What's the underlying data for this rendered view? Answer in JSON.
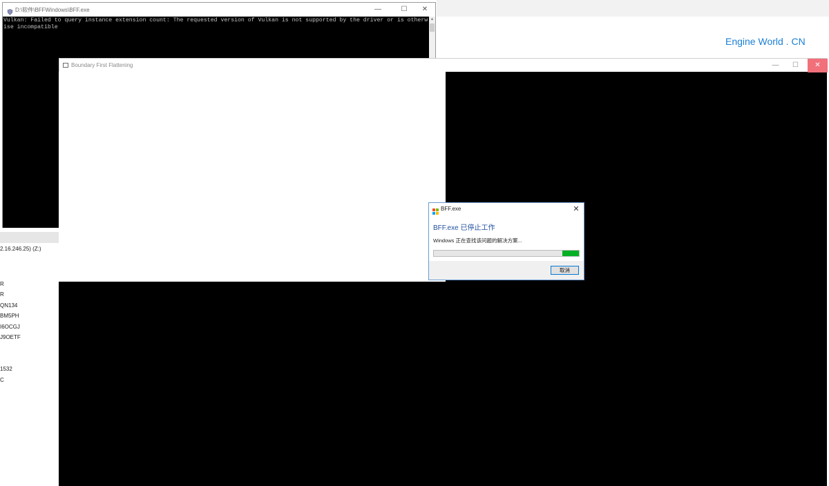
{
  "background": {
    "brand_text": "Engine World . CN",
    "sidebar_items": [
      "2.16.246.25) (Z:)",
      "R",
      "R",
      "QN134",
      "BM5PH",
      "I6OCGJ",
      "J9OETF",
      "1532",
      "C"
    ]
  },
  "console": {
    "title": "D:\\软件\\BFFWindows\\BFF.exe",
    "output": "Vulkan: Failed to query instance extension count: The requested version of Vulkan is not supported by the driver or is otherwise incompatible",
    "controls": {
      "minimize": "—",
      "maximize": "☐",
      "close": "✕"
    }
  },
  "bff_window": {
    "title": "Boundary First Flattening",
    "controls": {
      "minimize": "—",
      "maximize": "☐",
      "close": "✕"
    }
  },
  "dialog": {
    "title": "BFF.exe",
    "heading": "BFF.exe 已停止工作",
    "message": "Windows 正在查找该问题的解决方案...",
    "progress_state": "indeterminate",
    "progress_color": "#06b025",
    "cancel_label": "取消",
    "close": "✕"
  },
  "colors": {
    "accent_blue": "#1a7fd4",
    "dialog_heading": "#1f4f9e",
    "close_red": "#f1707a"
  }
}
